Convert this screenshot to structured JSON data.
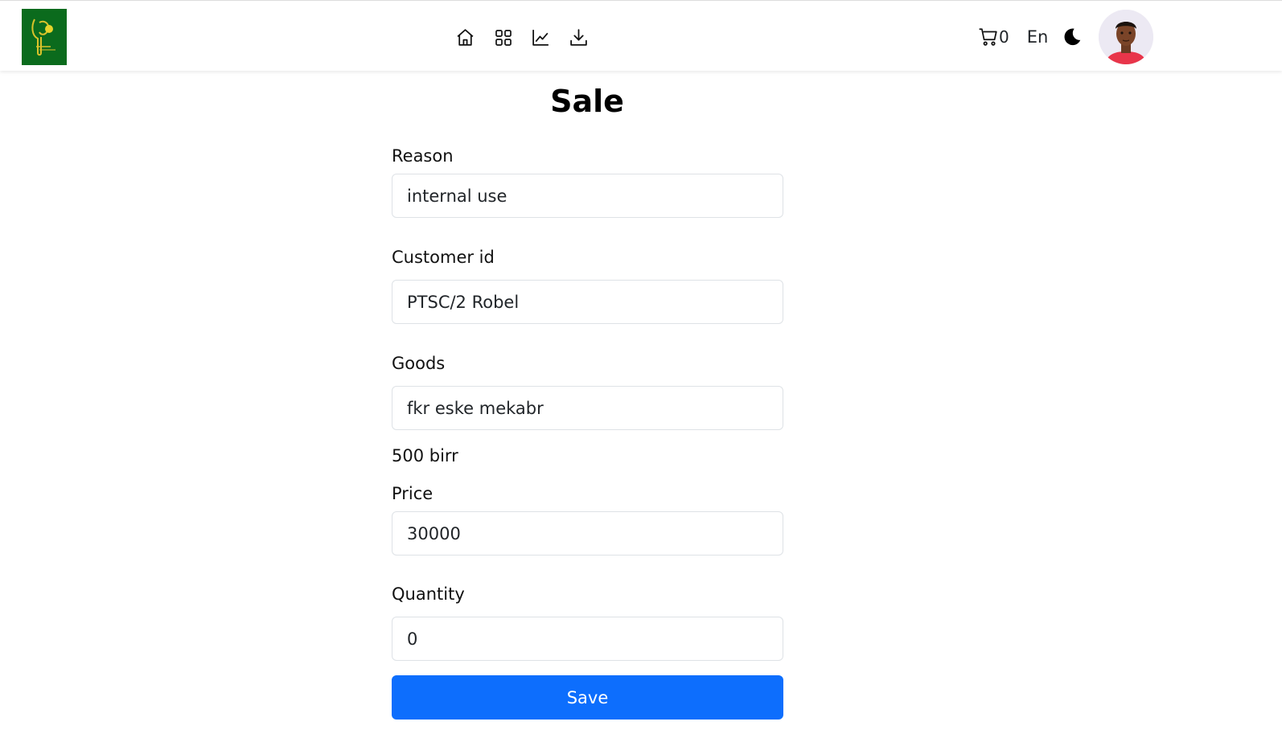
{
  "header": {
    "nav_icons": [
      "home-icon",
      "grid-icon",
      "chart-icon",
      "download-icon"
    ],
    "cart_count": "0",
    "language": "En",
    "theme_icon": "moon-icon",
    "brand_color": "#0b6b1d"
  },
  "page": {
    "title": "Sale"
  },
  "form": {
    "reason_label": "Reason",
    "reason_value": "internal use",
    "customer_label": "Customer id",
    "customer_value": "PTSC/2 Robel",
    "goods_label": "Goods",
    "goods_value": "fkr eske mekabr",
    "goods_note": "500 birr",
    "price_label": "Price",
    "price_value": "30000",
    "quantity_label": "Quantity",
    "quantity_value": "0",
    "save_label": "Save",
    "accent_color": "#0d6efd"
  }
}
